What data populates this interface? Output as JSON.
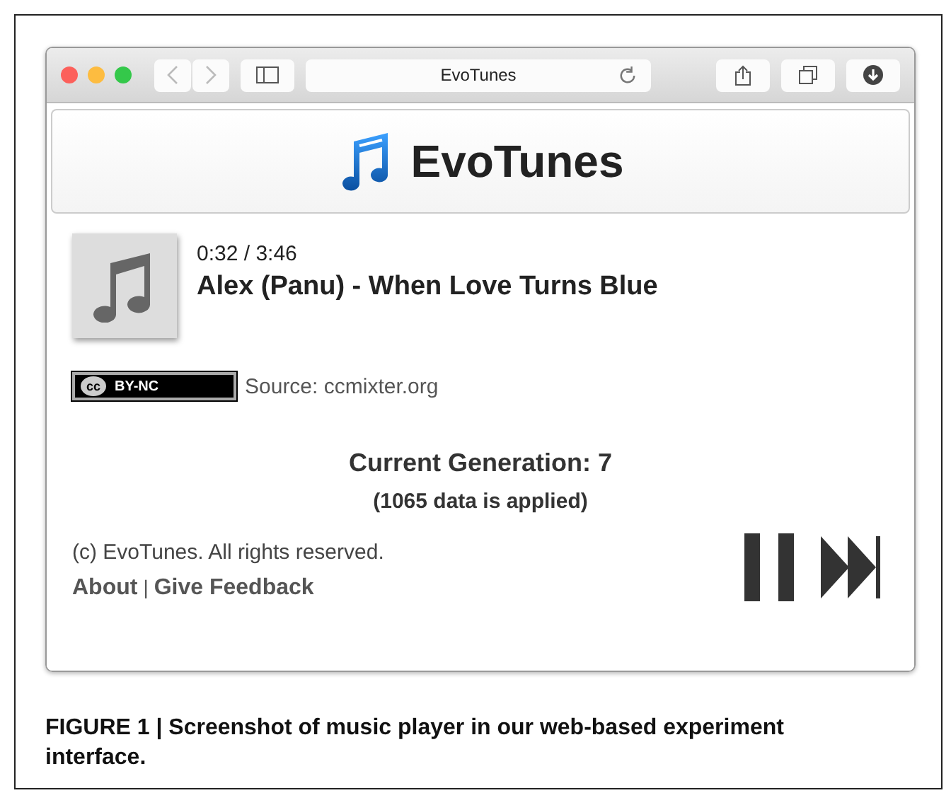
{
  "browser": {
    "address": "EvoTunes"
  },
  "site": {
    "logo_text": "EvoTunes"
  },
  "player": {
    "time": "0:32 / 3:46",
    "track": "Alex (Panu) - When Love Turns Blue",
    "license": {
      "cc": "cc",
      "label": "BY-NC"
    },
    "source": "Source: ccmixter.org",
    "generation": "Current Generation: 7",
    "data_applied": "(1065 data is applied)",
    "playing": true
  },
  "footer": {
    "copyright": "(c) EvoTunes. All rights reserved.",
    "links": [
      "About",
      "Give Feedback"
    ],
    "separator": "|"
  },
  "caption": "FIGURE 1 | Screenshot of music player in our web-based experiment interface."
}
